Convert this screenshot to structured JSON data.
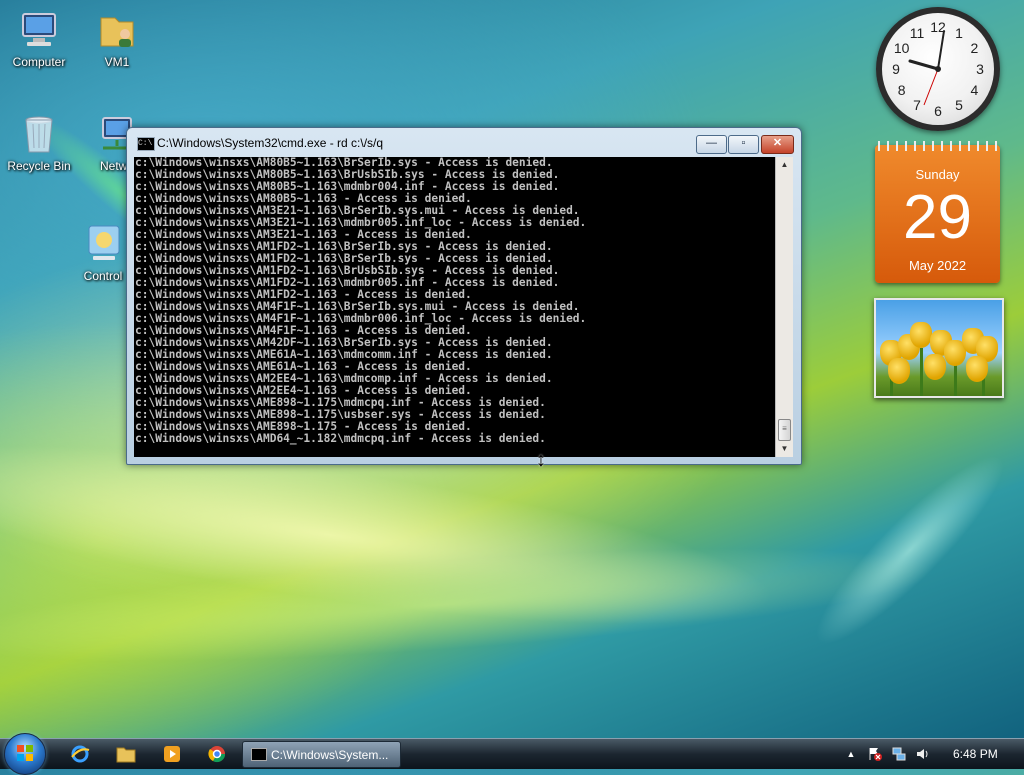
{
  "desktop": {
    "icons": [
      {
        "label": "Computer"
      },
      {
        "label": "VM1"
      },
      {
        "label": "Recycle Bin"
      },
      {
        "label": "Netwo"
      },
      {
        "label": "Control"
      }
    ]
  },
  "window": {
    "title": "C:\\Windows\\System32\\cmd.exe - rd  c:\\/s/q",
    "icon_text": "C:\\",
    "buttons": {
      "minimize": "—",
      "maximize": "▫",
      "close": "✕"
    },
    "lines": [
      "c:\\Windows\\winsxs\\AM80B5~1.163\\BrSerIb.sys - Access is denied.",
      "c:\\Windows\\winsxs\\AM80B5~1.163\\BrUsbSIb.sys - Access is denied.",
      "c:\\Windows\\winsxs\\AM80B5~1.163\\mdmbr004.inf - Access is denied.",
      "c:\\Windows\\winsxs\\AM80B5~1.163 - Access is denied.",
      "c:\\Windows\\winsxs\\AM3E21~1.163\\BrSerIb.sys.mui - Access is denied.",
      "c:\\Windows\\winsxs\\AM3E21~1.163\\mdmbr005.inf_loc - Access is denied.",
      "c:\\Windows\\winsxs\\AM3E21~1.163 - Access is denied.",
      "c:\\Windows\\winsxs\\AM1FD2~1.163\\BrSerIb.sys - Access is denied.",
      "c:\\Windows\\winsxs\\AM1FD2~1.163\\BrSerIb.sys - Access is denied.",
      "c:\\Windows\\winsxs\\AM1FD2~1.163\\BrUsbSIb.sys - Access is denied.",
      "c:\\Windows\\winsxs\\AM1FD2~1.163\\mdmbr005.inf - Access is denied.",
      "c:\\Windows\\winsxs\\AM1FD2~1.163 - Access is denied.",
      "c:\\Windows\\winsxs\\AM4F1F~1.163\\BrSerIb.sys.mui - Access is denied.",
      "c:\\Windows\\winsxs\\AM4F1F~1.163\\mdmbr006.inf_loc - Access is denied.",
      "c:\\Windows\\winsxs\\AM4F1F~1.163 - Access is denied.",
      "c:\\Windows\\winsxs\\AM42DF~1.163\\BrSerIb.sys - Access is denied.",
      "c:\\Windows\\winsxs\\AME61A~1.163\\mdmcomm.inf - Access is denied.",
      "c:\\Windows\\winsxs\\AME61A~1.163 - Access is denied.",
      "c:\\Windows\\winsxs\\AM2EE4~1.163\\mdmcomp.inf - Access is denied.",
      "c:\\Windows\\winsxs\\AM2EE4~1.163 - Access is denied.",
      "c:\\Windows\\winsxs\\AME898~1.175\\mdmcpq.inf - Access is denied.",
      "c:\\Windows\\winsxs\\AME898~1.175\\usbser.sys - Access is denied.",
      "c:\\Windows\\winsxs\\AME898~1.175 - Access is denied.",
      "c:\\Windows\\winsxs\\AMD64_~1.182\\mdmcpq.inf - Access is denied."
    ]
  },
  "gadgets": {
    "clock": {
      "numbers": [
        "12",
        "1",
        "2",
        "3",
        "4",
        "5",
        "6",
        "7",
        "8",
        "9",
        "10",
        "11"
      ]
    },
    "calendar": {
      "day_name": "Sunday",
      "day": "29",
      "month_year": "May 2022"
    }
  },
  "taskbar": {
    "task_label": "C:\\Windows\\System...",
    "time": "6:48 PM",
    "tray_arrow": "▲"
  },
  "colors": {
    "console_bg": "#000000",
    "console_fg": "#c0c0c0",
    "calendar_orange": "#e8731a"
  }
}
